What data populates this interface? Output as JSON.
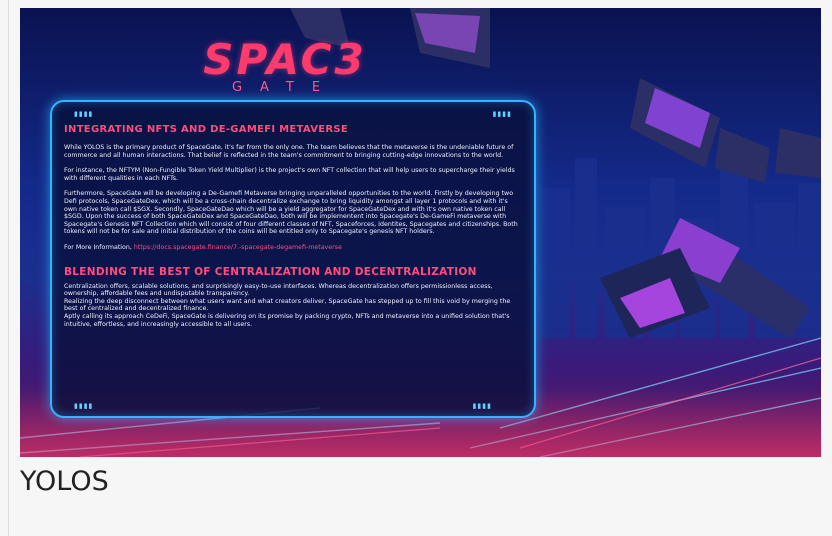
{
  "logo": {
    "title": "SPAC3",
    "subtitle": "GATE"
  },
  "panel": {
    "heading1": "INTEGRATING NFTS AND DE-GAMEFI METAVERSE",
    "p1": "While YOLOS is the primary product of SpaceGate, it's far from the only one. The team believes that the metaverse is the undeniable future of commerce and all human interactions. That belief is reflected in the team's commitment to bringing cutting-edge innovations to the world.",
    "p2": "For instance, the NFTYM (Non-Fungible Token Yield Multiplier) is the project's own NFT collection that will help users to supercharge their yields with different qualities in each NFTs.",
    "p3": "Furthermore, SpaceGate will be developing a De-Gamefi Metaverse bringing unparalleled opportunities to the world. Firstly by developing two Defi protocols, SpaceGateDex, which will be a cross-chain decentralize exchange to bring liquidity amongst all layer 1 protocols and with it's own native token call $SGX. Secondly, SpaceGateDao which will be a yield aggregator for SpaceGateDex and with it's own native token call $SGD. Upon the success of both SpaceGateDex and SpaceGateDao, both will be implementent into Spacegate's De-GameFi metaverse with Spacegate's Genesis NFT Collection which will consist of four different classes of NFT, Spaceforces, Identites, Spacegates and citizenships. Both tokens will not be for sale and initial distribution of the coins will be entitled only to Spacegate's genesis NFT holders.",
    "more_prefix": "For More Information,",
    "more_link": "https://docs.spacegate.finance/7.-spacegate-degamefi-metaverse",
    "heading2": "BLENDING THE BEST OF CENTRALIZATION AND DECENTRALIZATION",
    "p4": "Centralization offers, scalable solutions, and surprisingly easy-to-use interfaces. Whereas decentralization offers permissionless access, ownership, affordable fees and undisputable transparency.",
    "p5": "Realizing the deep disconnect between what users want and what creators deliver, SpaceGate has stepped up to fill this void by merging the best of centralized and decentralized finance.",
    "p6": "Aptly calling its approach CeDeFi, SpaceGate is delivering on its promise by packing crypto, NFTs and metaverse into a unified solution that's intuitive, effortless, and increasingly accessible to all users."
  },
  "caption": "YOLOS",
  "colors": {
    "accent": "#ff4d7e",
    "border": "#2fb6ff",
    "panel_bg": "#0a103c"
  }
}
